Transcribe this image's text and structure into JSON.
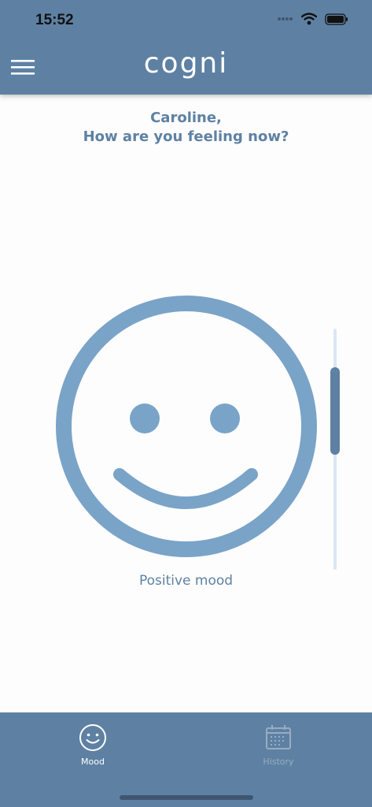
{
  "status_bar": {
    "time": "15:52"
  },
  "header": {
    "title": "cogni",
    "menu_icon": "hamburger-menu-icon"
  },
  "greeting": {
    "line1": "Caroline,",
    "line2": "How are you feeling now?"
  },
  "mood": {
    "label": "Positive mood",
    "face_icon": "smiley-face-icon",
    "slider_value_fraction": 0.2
  },
  "tabs": [
    {
      "label": "Mood",
      "icon": "smiley-icon",
      "active": true
    },
    {
      "label": "History",
      "icon": "calendar-icon",
      "active": false
    }
  ],
  "colors": {
    "brand": "#5e81a3",
    "face": "#7aa3c8",
    "inactive_tab": "#98acc3",
    "track": "#dde6f2"
  }
}
